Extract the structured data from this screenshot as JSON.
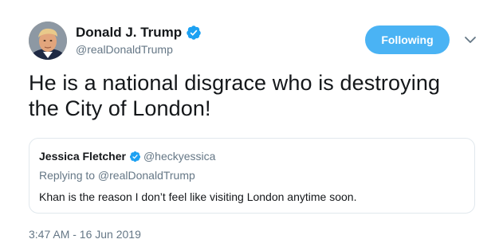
{
  "tweet": {
    "author": {
      "name": "Donald J. Trump",
      "handle": "@realDonaldTrump",
      "verified": true
    },
    "follow_button_label": "Following",
    "text": "He is a national disgrace who is destroying the City of London!",
    "quoted_tweet": {
      "author_name": "Jessica Fletcher",
      "author_handle": "@heckyessica",
      "verified": true,
      "replying_to": "Replying to @realDonaldTrump",
      "text": "Khan is the reason I don’t feel like visiting London anytime soon."
    },
    "timestamp": "3:47 AM - 16 Jun 2019"
  },
  "icons": {
    "verified": "verified-badge-icon",
    "more": "chevron-down-icon"
  },
  "colors": {
    "accent": "#1da1f2",
    "follow_button": "#4ab3f4",
    "secondary_text": "#657786",
    "primary_text": "#14171a",
    "card_border": "#e1e8ed"
  }
}
